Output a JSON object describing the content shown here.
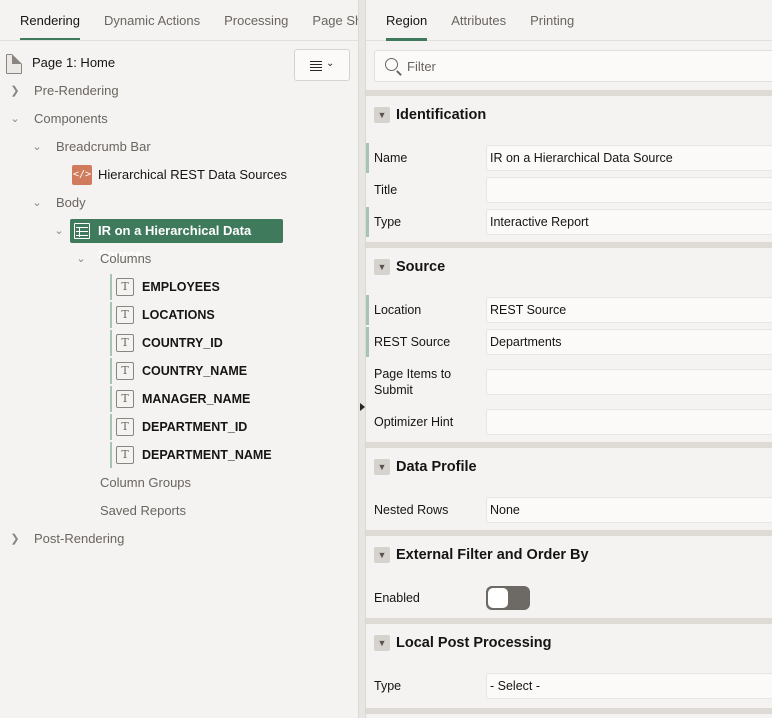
{
  "left_tabs": [
    "Rendering",
    "Dynamic Actions",
    "Processing",
    "Page Share"
  ],
  "tree": {
    "page": "Page 1: Home",
    "pre_rendering": "Pre-Rendering",
    "components": "Components",
    "breadcrumb_bar": "Breadcrumb Bar",
    "breadcrumb_region": "Hierarchical REST Data Sources",
    "body": "Body",
    "selected_region": "IR on a Hierarchical Data Source",
    "columns_label": "Columns",
    "columns": [
      "EMPLOYEES",
      "LOCATIONS",
      "COUNTRY_ID",
      "COUNTRY_NAME",
      "MANAGER_NAME",
      "DEPARTMENT_ID",
      "DEPARTMENT_NAME"
    ],
    "column_groups": "Column Groups",
    "saved_reports": "Saved Reports",
    "post_rendering": "Post-Rendering"
  },
  "right_tabs": [
    "Region",
    "Attributes",
    "Printing"
  ],
  "filter_placeholder": "Filter",
  "sections": {
    "identification": {
      "title": "Identification",
      "name_label": "Name",
      "name_value": "IR on a Hierarchical Data Source",
      "title_label": "Title",
      "title_value": "",
      "type_label": "Type",
      "type_value": "Interactive Report"
    },
    "source": {
      "title": "Source",
      "location_label": "Location",
      "location_value": "REST Source",
      "rest_source_label": "REST Source",
      "rest_source_value": "Departments",
      "page_items_label_1": "Page Items to",
      "page_items_label_2": "Submit",
      "page_items_value": "",
      "optimizer_label": "Optimizer Hint",
      "optimizer_value": ""
    },
    "data_profile": {
      "title": "Data Profile",
      "nested_rows_label": "Nested Rows",
      "nested_rows_value": "None"
    },
    "external_filter": {
      "title": "External Filter and Order By",
      "enabled_label": "Enabled",
      "enabled": false
    },
    "local_post": {
      "title": "Local Post Processing",
      "type_label": "Type",
      "type_value": "- Select -"
    }
  },
  "colors": {
    "accent": "#3f7a5c",
    "breadcrumb_icon": "#d07b5b",
    "required_bar": "#a7c4b3"
  }
}
